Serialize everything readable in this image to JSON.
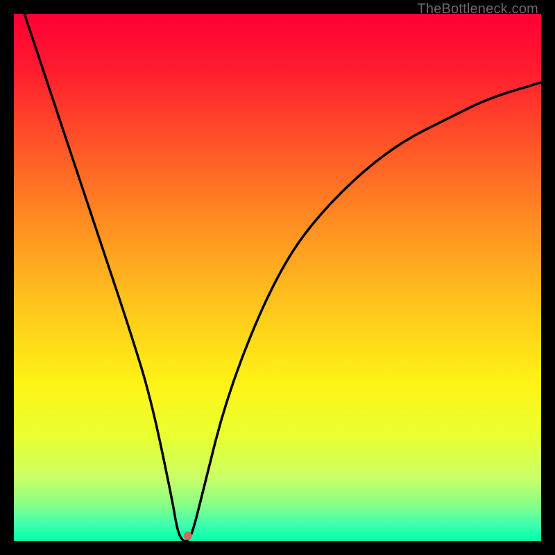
{
  "watermark": "TheBottleneck.com",
  "chart_data": {
    "type": "line",
    "title": "",
    "xlabel": "",
    "ylabel": "",
    "xlim": [
      0,
      100
    ],
    "ylim": [
      0,
      100
    ],
    "grid": false,
    "gradient_stops": [
      {
        "offset": 0.0,
        "color": "#ff0033"
      },
      {
        "offset": 0.1,
        "color": "#ff1a2f"
      },
      {
        "offset": 0.25,
        "color": "#ff5528"
      },
      {
        "offset": 0.4,
        "color": "#ff8f22"
      },
      {
        "offset": 0.55,
        "color": "#ffc41c"
      },
      {
        "offset": 0.7,
        "color": "#fff316"
      },
      {
        "offset": 0.8,
        "color": "#eaff30"
      },
      {
        "offset": 0.88,
        "color": "#c9ff66"
      },
      {
        "offset": 0.93,
        "color": "#8aff88"
      },
      {
        "offset": 0.97,
        "color": "#3affb0"
      },
      {
        "offset": 1.0,
        "color": "#00ffa7"
      }
    ],
    "curve": {
      "x": [
        2,
        6,
        10,
        14,
        18,
        22,
        26,
        30,
        31,
        32,
        33,
        34,
        36,
        40,
        46,
        52,
        58,
        66,
        74,
        82,
        90,
        100
      ],
      "y": [
        100,
        88,
        76,
        64,
        52,
        40,
        27,
        8,
        2,
        0,
        0,
        2,
        10,
        26,
        42,
        54,
        62,
        70,
        76,
        80,
        84,
        87
      ]
    },
    "marker": {
      "x": 33,
      "y": 1,
      "color": "#c96a5a",
      "radius": 6
    }
  }
}
